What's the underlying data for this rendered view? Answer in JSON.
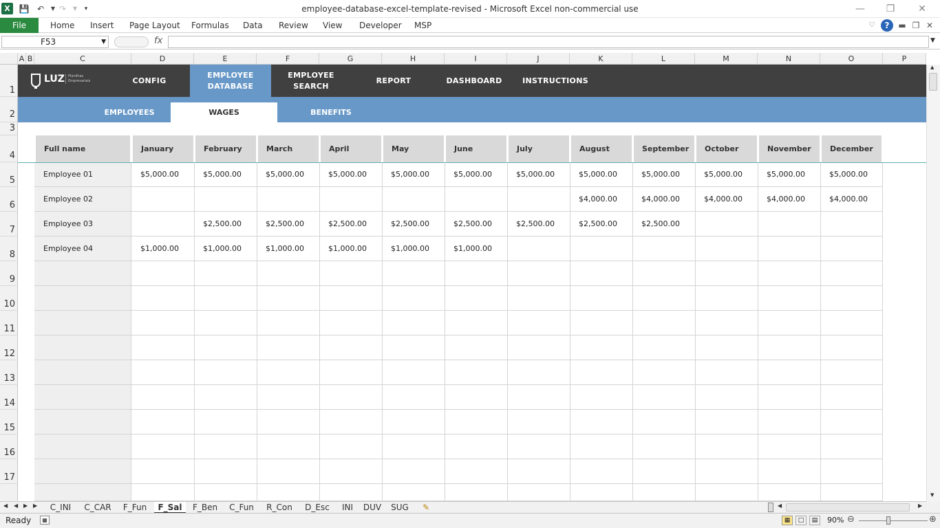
{
  "window": {
    "title": "employee-database-excel-template-revised  -  Microsoft Excel non-commercial use"
  },
  "ribbon": {
    "file": "File",
    "tabs": [
      "Home",
      "Insert",
      "Page Layout",
      "Formulas",
      "Data",
      "Review",
      "View",
      "Developer",
      "MSP"
    ]
  },
  "formula_bar": {
    "name_box": "F53",
    "fx": "fx",
    "formula": ""
  },
  "columns": [
    "A",
    "B",
    "C",
    "D",
    "E",
    "F",
    "G",
    "H",
    "I",
    "J",
    "K",
    "L",
    "M",
    "N",
    "O",
    "P"
  ],
  "rows": [
    "1",
    "2",
    "3",
    "4",
    "5",
    "6",
    "7",
    "8",
    "9",
    "10",
    "11",
    "12",
    "13",
    "14",
    "15",
    "16",
    "17"
  ],
  "nav": {
    "logo": "LUZ",
    "logo_sub": "Planilhas Empresariais",
    "items": [
      "CONFIG",
      "EMPLOYEE DATABASE",
      "EMPLOYEE SEARCH",
      "REPORT",
      "DASHBOARD",
      "INSTRUCTIONS"
    ],
    "active": "EMPLOYEE DATABASE"
  },
  "subnav": {
    "items": [
      "EMPLOYEES",
      "WAGES",
      "BENEFITS"
    ],
    "active": "WAGES"
  },
  "table": {
    "headers": [
      "Full name",
      "January",
      "February",
      "March",
      "April",
      "May",
      "June",
      "July",
      "August",
      "September",
      "October",
      "November",
      "December"
    ],
    "rows": [
      [
        "Employee 01",
        "$5,000.00",
        "$5,000.00",
        "$5,000.00",
        "$5,000.00",
        "$5,000.00",
        "$5,000.00",
        "$5,000.00",
        "$5,000.00",
        "$5,000.00",
        "$5,000.00",
        "$5,000.00",
        "$5,000.00"
      ],
      [
        "Employee 02",
        "",
        "",
        "",
        "",
        "",
        "",
        "",
        "$4,000.00",
        "$4,000.00",
        "$4,000.00",
        "$4,000.00",
        "$4,000.00"
      ],
      [
        "Employee 03",
        "",
        "$2,500.00",
        "$2,500.00",
        "$2,500.00",
        "$2,500.00",
        "$2,500.00",
        "$2,500.00",
        "$2,500.00",
        "$2,500.00",
        "",
        "",
        ""
      ],
      [
        "Employee 04",
        "$1,000.00",
        "$1,000.00",
        "$1,000.00",
        "$1,000.00",
        "$1,000.00",
        "$1,000.00",
        "",
        "",
        "",
        "",
        "",
        ""
      ]
    ]
  },
  "sheets": {
    "tabs": [
      "C_INI",
      "C_CAR",
      "F_Fun",
      "F_Sal",
      "F_Ben",
      "C_Fun",
      "R_Con",
      "D_Esc",
      "INI",
      "DUV",
      "SUG"
    ],
    "active": "F_Sal"
  },
  "status": {
    "ready": "Ready",
    "zoom": "90%"
  }
}
